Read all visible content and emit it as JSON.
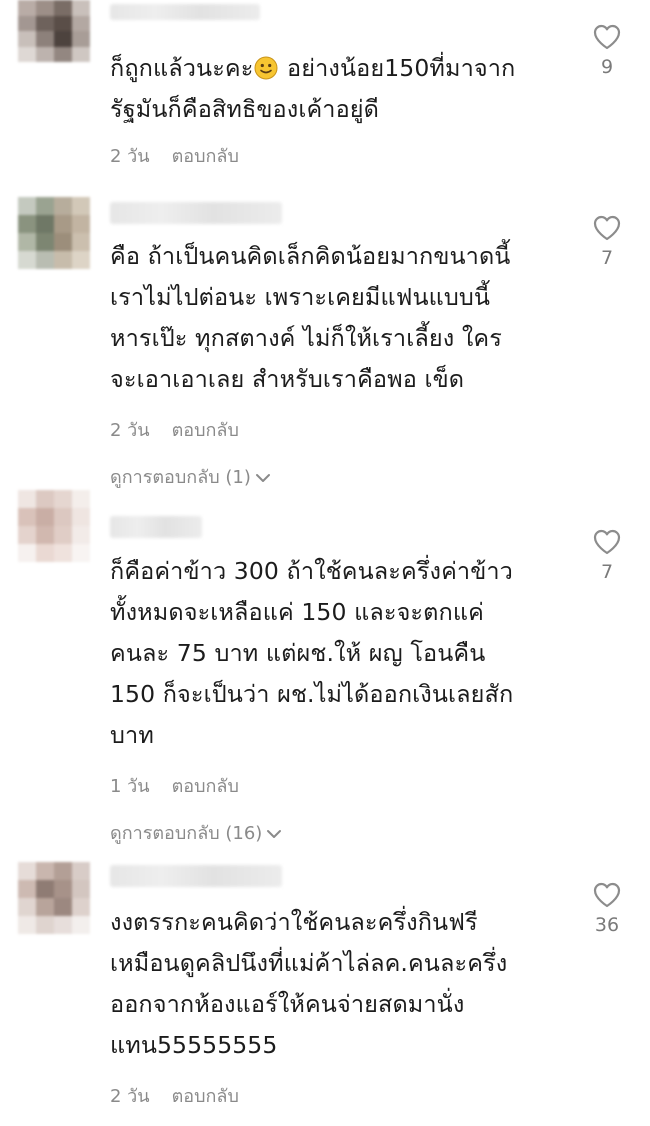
{
  "colors": {
    "text": "#1c1c1c",
    "meta": "#8a8a8a",
    "heart_stroke": "#8c8c8c"
  },
  "comments": [
    {
      "lines": [
        "ก็ถูกแล้วนะคะ",
        "รัฐมันก็คือสิทธิของเค้าอยู่ดี"
      ],
      "line1_after_emoji": " อย่างน้อย150ที่มาจาก",
      "emoji": "slightly-smiling-face-emoji",
      "time": "2 วัน",
      "reply": "ตอบกลับ",
      "likes": "9",
      "avatar_colors": [
        "#b9aca6",
        "#9d8f88",
        "#7a6d66",
        "#c9c0bb",
        "#a39792",
        "#6e625c",
        "#5a4e48",
        "#b3a8a2",
        "#c8bfba",
        "#8d817b",
        "#4d433e",
        "#a89d97",
        "#ded8d4",
        "#bdb3ae",
        "#938781",
        "#cfc7c2"
      ]
    },
    {
      "lines": [
        "คือ ถ้าเป็นคนคิดเล็กคิดน้อยมากขนาดนี้",
        "เราไม่ไปต่อนะ เพราะเคยมีแฟนแบบนี้",
        "หารเป๊ะ ทุกสตางค์ ไม่ก็ให้เราเลี้ยง ใคร",
        "จะเอาเอาเลย สำหรับเราคือพอ เข็ด"
      ],
      "time": "2 วัน",
      "reply": "ตอบกลับ",
      "likes": "7",
      "view_replies": "ดูการตอบกลับ (1)",
      "avatar_colors": [
        "#c4c9bf",
        "#9aa391",
        "#b7ad9c",
        "#d2c8b8",
        "#8a937f",
        "#6f7866",
        "#a89a87",
        "#c2b4a2",
        "#b0b7a6",
        "#7d8672",
        "#9c8e7b",
        "#cbbfae",
        "#d6d9d1",
        "#b9bdb2",
        "#c7bcab",
        "#ddd4c6"
      ]
    },
    {
      "lines": [
        "ก็คือค่าข้าว 300 ถ้าใช้คนละครึ่งค่าข้าว",
        "ทั้งหมดจะเหลือแค่ 150 และจะตกแค่",
        "คนละ 75 บาท แต่ผช.ให้ ผญ โอนคืน",
        "150 ก็จะเป็นว่า ผช.ไม่ได้ออกเงินเลยสัก",
        "บาท"
      ],
      "time": "1 วัน",
      "reply": "ตอบกลับ",
      "likes": "7",
      "view_replies": "ดูการตอบกลับ (16)",
      "avatar_colors": [
        "#efe6e2",
        "#dcc9c2",
        "#e5d6d0",
        "#f4eeeb",
        "#d9c2ba",
        "#c9aea5",
        "#dcc8c1",
        "#efe5e1",
        "#e4d3cd",
        "#d1b8af",
        "#e0cdc6",
        "#f2ebe8",
        "#f6f1ef",
        "#ead9d3",
        "#efe2dd",
        "#f8f4f2"
      ]
    },
    {
      "lines": [
        "งงตรรกะคนคิดว่าใช้คนละครึ่งกินฟรี",
        "เหมือนดูคลิปนึงที่แม่ค้าไล่ลค.คนละครึ่ง",
        "ออกจากห้องแอร์ให้คนจ่ายสดมานั่ง",
        "แทน55555555"
      ],
      "time": "2 วัน",
      "reply": "ตอบกลับ",
      "likes": "36",
      "avatar_colors": [
        "#e6dcd8",
        "#c9b6ae",
        "#b39f96",
        "#d8ccc7",
        "#cdbab2",
        "#8f7c74",
        "#a79289",
        "#d3c6c0",
        "#e0d5d0",
        "#b8a49b",
        "#9c8880",
        "#ddd1cc",
        "#efe9e6",
        "#dfd4cf",
        "#e7dedb",
        "#f3efed"
      ]
    }
  ]
}
